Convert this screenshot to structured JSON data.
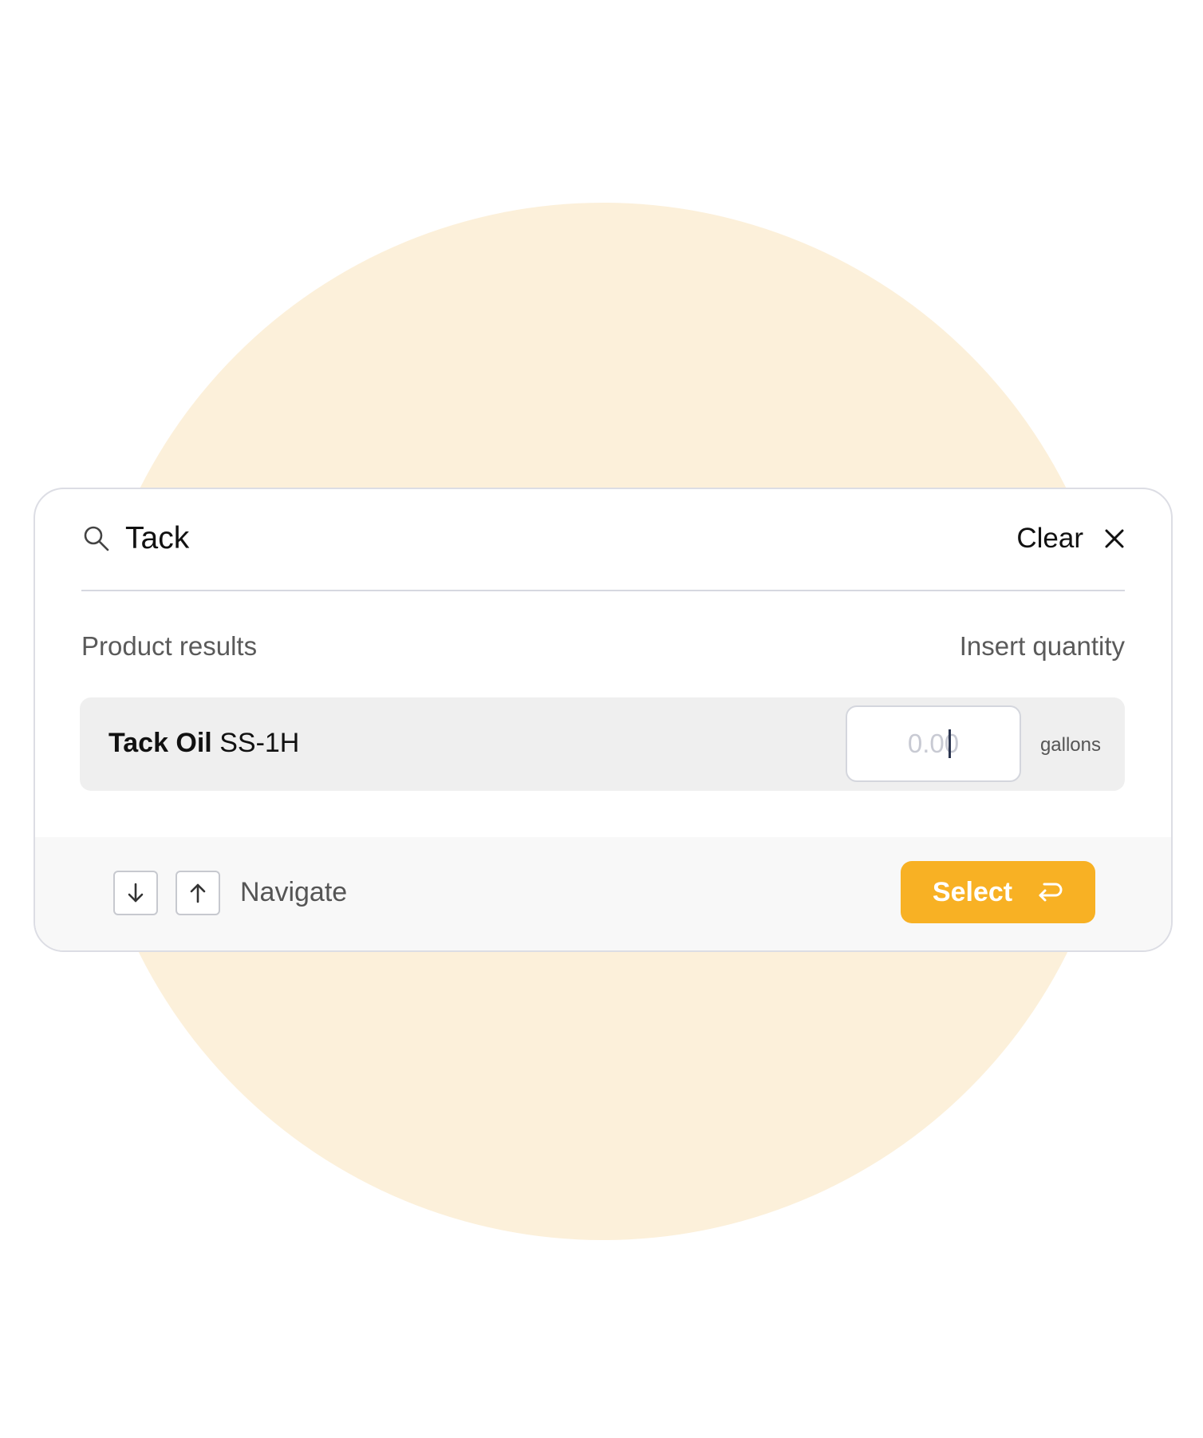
{
  "search": {
    "value": "Tack",
    "clear_label": "Clear",
    "icon": "search-icon"
  },
  "results": {
    "header_left": "Product results",
    "header_right": "Insert quantity",
    "items": [
      {
        "name_bold": "Tack Oil",
        "name_rest": " SS-1H",
        "quantity_value": "",
        "quantity_placeholder": "0.00",
        "unit": "gallons"
      }
    ]
  },
  "footer": {
    "down_icon": "arrow-down-icon",
    "up_icon": "arrow-up-icon",
    "navigate_label": "Navigate",
    "select_label": "Select",
    "select_icon": "enter-return-icon"
  },
  "colors": {
    "accent": "#f8b124",
    "background_circle": "#fcf0da",
    "row_highlight": "#efefef",
    "footer_bg": "#f8f8f8"
  }
}
